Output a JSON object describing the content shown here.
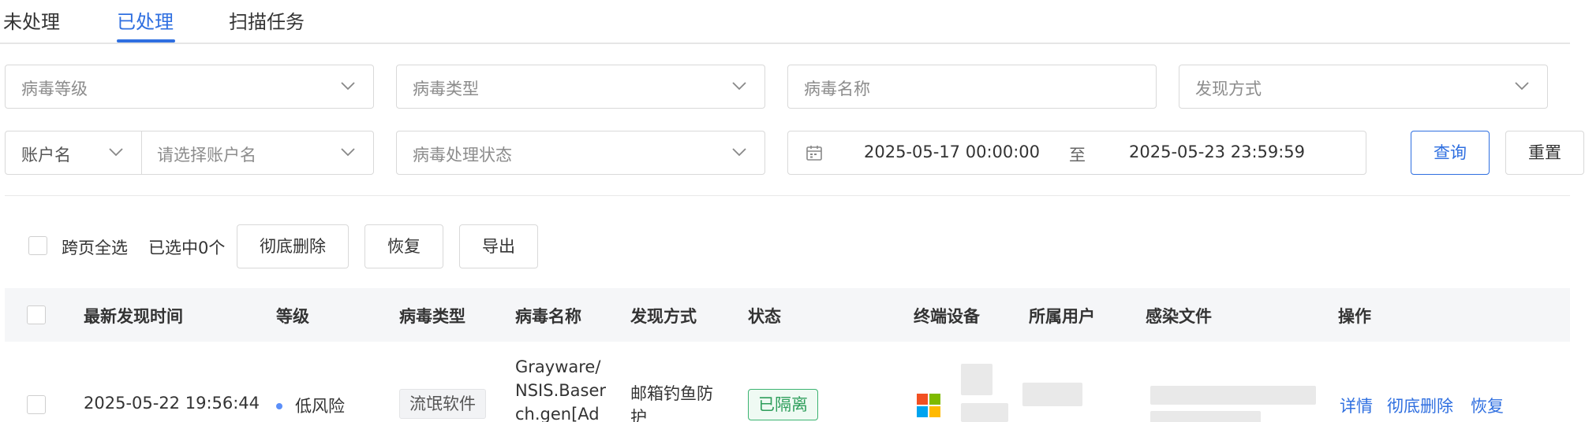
{
  "tabs": [
    {
      "label": "未处理"
    },
    {
      "label": "已处理"
    },
    {
      "label": "扫描任务"
    }
  ],
  "filters": {
    "virus_level_placeholder": "病毒等级",
    "virus_type_placeholder": "病毒类型",
    "virus_name_placeholder": "病毒名称",
    "discovery_method_placeholder": "发现方式",
    "account_label": "账户名",
    "account_placeholder": "请选择账户名",
    "status_placeholder": "病毒处理状态",
    "date_start": "2025-05-17 00:00:00",
    "date_separator": "至",
    "date_end": "2025-05-23 23:59:59",
    "query_button": "查询",
    "reset_button": "重置"
  },
  "toolbar": {
    "select_all_pages": "跨页全选",
    "selected_count": "已选中0个",
    "delete_button": "彻底删除",
    "restore_button": "恢复",
    "export_button": "导出"
  },
  "table": {
    "columns": [
      "最新发现时间",
      "等级",
      "病毒类型",
      "病毒名称",
      "发现方式",
      "状态",
      "终端设备",
      "所属用户",
      "感染文件",
      "操作"
    ],
    "rows": [
      {
        "time": "2025-05-22 19:56:44",
        "level": "低风险",
        "type": "流氓软件",
        "name_line1": "Grayware/",
        "name_line2": "NSIS.Baser",
        "name_line3": "ch.gen[Ad",
        "method_line1": "邮箱钓鱼防",
        "method_line2": "护",
        "status": "已隔离",
        "actions": {
          "detail": "详情",
          "delete": "彻底删除",
          "restore": "恢复"
        }
      }
    ]
  },
  "colors": {
    "accent": "#2f6fe0",
    "status_green": "#2e9e5b",
    "level_dot": "#5b8ff9"
  }
}
